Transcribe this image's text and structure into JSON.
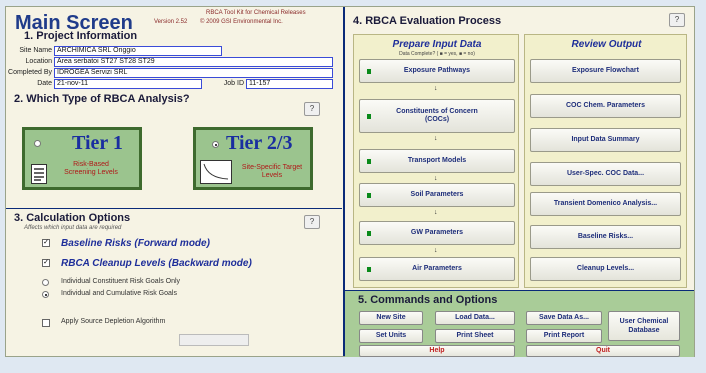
{
  "header": {
    "title": "Main Screen",
    "version": "Version 2.52",
    "kit_name": "RBCA Tool Kit for Chemical Releases",
    "copyright": "© 2009 GSI Environmental Inc."
  },
  "project": {
    "section_title": "1. Project Information",
    "site_name_label": "Site Name",
    "site_name": "ARCHIMICA SRL Origgio",
    "location_label": "Location",
    "location": "Area serbatoi ST27 ST28 ST29",
    "completed_by_label": "Completed By",
    "completed_by": "IDROGEA Servizi SRL",
    "date_label": "Date",
    "date": "21-nov-11",
    "job_id_label": "Job ID",
    "job_id": "11-157"
  },
  "analysis": {
    "section_title": "2. Which Type of RBCA Analysis?",
    "help": "?",
    "tier1": {
      "title": "Tier 1",
      "subtitle": "Risk-Based Screening Levels",
      "selected": false
    },
    "tier23": {
      "title": "Tier 2/3",
      "subtitle": "Site-Specific Target Levels",
      "selected": true
    }
  },
  "calc": {
    "section_title": "3. Calculation Options",
    "note": "Affects which input data are required",
    "help": "?",
    "baseline": {
      "label": "Baseline Risks (Forward mode)",
      "checked": true
    },
    "cleanup": {
      "label": "RBCA Cleanup Levels (Backward mode)",
      "checked": true
    },
    "radio1": {
      "label": "Individual Constituent Risk Goals Only",
      "selected": false
    },
    "radio2": {
      "label": "Individual and Cumulative Risk Goals",
      "selected": true
    },
    "depletion": {
      "label": "Apply Source Depletion Algorithm",
      "checked": false
    }
  },
  "eval": {
    "section_title": "4. RBCA Evaluation Process",
    "help": "?",
    "prepare": {
      "title": "Prepare Input Data",
      "legend": "Data Complete? ( ■ = yes, ■ = no)",
      "buttons": [
        "Exposure Pathways",
        "Constituents of Concern (COCs)",
        "Transport Models",
        "Soil Parameters",
        "GW Parameters",
        "Air Parameters"
      ]
    },
    "review": {
      "title": "Review Output",
      "buttons": [
        "Exposure Flowchart",
        "COC Chem. Parameters",
        "Input Data Summary",
        "User-Spec. COC Data...",
        "Transient Domenico Analysis...",
        "Baseline Risks...",
        "Cleanup Levels..."
      ]
    }
  },
  "commands": {
    "section_title": "5. Commands and Options",
    "new_site": "New Site",
    "load_data": "Load Data...",
    "save_data": "Save Data As...",
    "user_chem": "User Chemical Database",
    "set_units": "Set Units",
    "print_sheet": "Print Sheet",
    "print_report": "Print Report",
    "help": "Help",
    "quit": "Quit"
  },
  "colors": {
    "accent": "#1e2e9a",
    "status_green": "#0a8a1a",
    "status_red": "#c02020",
    "panel_green": "#a9cc98"
  }
}
